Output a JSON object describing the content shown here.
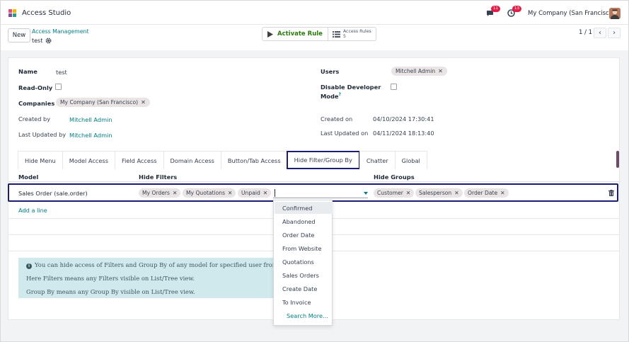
{
  "app": {
    "title": "Access Studio",
    "company": "My Company (San Francisco)",
    "chat_badge": "11",
    "activity_badge": "13"
  },
  "control": {
    "new_label": "New",
    "breadcrumb_parent": "Access Management",
    "breadcrumb_current": "test",
    "activate_label": "Activate Rule",
    "access_rules_label": "Access Rules",
    "access_rules_count": "5",
    "pager": "1 / 1"
  },
  "form": {
    "name_label": "Name",
    "name_value": "test",
    "readonly_label": "Read-Only",
    "companies_label": "Companies",
    "companies_tag": "My Company (San Francisco)",
    "created_by_label": "Created by",
    "created_by_value": "Mitchell Admin",
    "updated_by_label": "Last Updated by",
    "updated_by_value": "Mitchell Admin",
    "users_label": "Users",
    "users_tag": "Mitchell Admin",
    "devmode_label_1": "Disable Developer",
    "devmode_label_2": "Mode",
    "created_on_label": "Created on",
    "created_on_value": "04/10/2024 17:30:41",
    "updated_on_label": "Last Updated on",
    "updated_on_value": "04/11/2024 18:13:40"
  },
  "tabs": [
    "Hide Menu",
    "Model Access",
    "Field Access",
    "Domain Access",
    "Button/Tab Access",
    "Hide Filter/Group By",
    "Chatter",
    "Global"
  ],
  "list": {
    "col_model": "Model",
    "col_filters": "Hide Filters",
    "col_groups": "Hide Groups",
    "row_model": "Sales Order (sale.order)",
    "filters": [
      "My Orders",
      "My Quotations",
      "Unpaid"
    ],
    "groups": [
      "Customer",
      "Salesperson",
      "Order Date"
    ],
    "add_line": "Add a line"
  },
  "info": {
    "line1": "You can hide access of Filters and Group By of any model for specified user from",
    "line2": "Here Filters means any Filters visible on List/Tree view.",
    "line3": "Group By means any Group By visible on List/Tree view."
  },
  "dropdown": {
    "items": [
      "Confirmed",
      "Abandoned",
      "Order Date",
      "From Website",
      "Quotations",
      "Sales Orders",
      "Create Date",
      "To Invoice"
    ],
    "search_more": "Search More..."
  },
  "icons": [
    "app-logo-icon",
    "chat-icon",
    "clock-icon",
    "gear-icon",
    "play-icon",
    "list-icon",
    "chevron-left-icon",
    "chevron-right-icon",
    "close-icon",
    "caret-down-icon",
    "trash-icon",
    "info-icon"
  ]
}
